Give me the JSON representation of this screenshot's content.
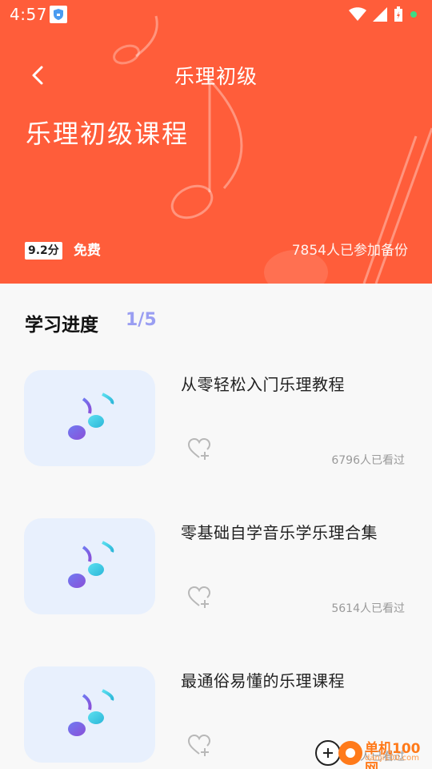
{
  "status_bar": {
    "time": "4:57"
  },
  "header": {
    "nav_title": "乐理初级",
    "course_title": "乐理初级课程",
    "score_badge": "9.2分",
    "price_label": "免费",
    "participants": "7854人已参加备份"
  },
  "progress": {
    "heading": "学习进度",
    "value": "1/5"
  },
  "lessons": [
    {
      "title": "从零轻松入门乐理教程",
      "views": "6796人已看过"
    },
    {
      "title": "零基础自学音乐学乐理合集",
      "views": "5614人已看过"
    },
    {
      "title": "最通俗易懂的乐理课程",
      "views": "人已看过"
    }
  ],
  "watermark": {
    "text": "单机100网",
    "url": "danji100.com"
  },
  "colors": {
    "hero": "#ff5d3a",
    "progress": "#9a9ef2",
    "thumb_bg": "#e8f0fd"
  }
}
